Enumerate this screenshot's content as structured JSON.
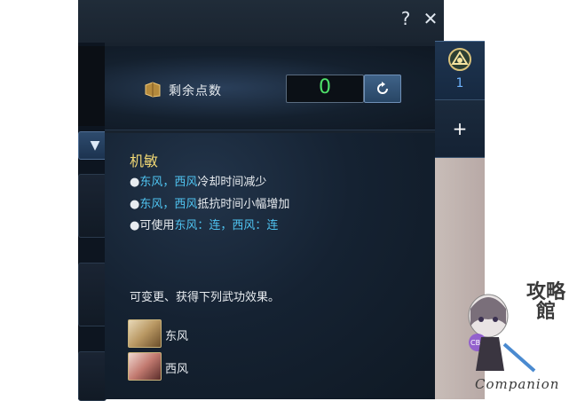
{
  "window": {
    "help_icon": "question-icon",
    "help_glyph": "?",
    "close_icon": "close-icon",
    "close_glyph": "✕"
  },
  "points": {
    "label": "剩余点数",
    "value": "0",
    "reset_icon": "reset-icon",
    "book_icon": "book-icon"
  },
  "skill": {
    "title": "机敏",
    "effects": [
      {
        "bullet": "●",
        "parts": [
          {
            "t": "东风，西风",
            "hl": true
          },
          {
            "t": "冷却时间减少",
            "hl": false
          }
        ]
      },
      {
        "bullet": "●",
        "parts": [
          {
            "t": "东风，西风",
            "hl": true
          },
          {
            "t": "抵抗时间小幅增加",
            "hl": false
          }
        ]
      },
      {
        "bullet": "●",
        "parts": [
          {
            "t": "可使用",
            "hl": false
          },
          {
            "t": "东风：连，西风：连",
            "hl": true
          }
        ]
      }
    ],
    "change_note": "可变更、获得下列武功效果。",
    "wuxue": [
      {
        "label": "东风",
        "icon": "dongfeng-skill-icon"
      },
      {
        "label": "西风",
        "icon": "xifeng-skill-icon"
      }
    ]
  },
  "tabs": {
    "active_number": "1",
    "active_icon": "class-emblem-icon",
    "add_glyph": "+"
  },
  "dropdown": {
    "glyph": "▼"
  },
  "watermark": {
    "text": "Companion",
    "cn": "攻略館",
    "badge": "CBR"
  },
  "colors": {
    "title_gold": "#f0d774",
    "highlight_blue": "#4fc3f0",
    "points_green": "#4ee06a"
  }
}
